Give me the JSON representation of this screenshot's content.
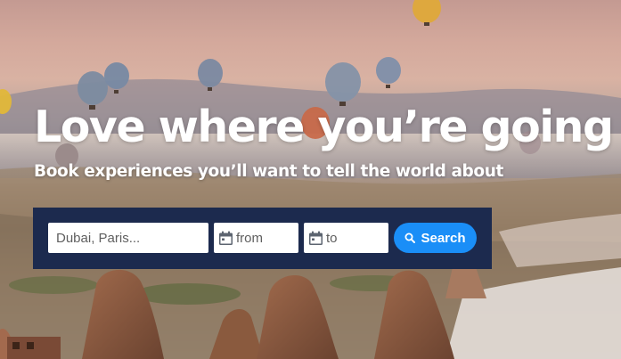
{
  "hero": {
    "headline": "Love where you’re going",
    "subheadline": "Book experiences you’ll want to tell the world about"
  },
  "search": {
    "destination_placeholder": "Dubai, Paris...",
    "from_placeholder": "from",
    "to_placeholder": "to",
    "button_label": "Search"
  },
  "colors": {
    "panel_bg": "#1c2a4e",
    "button_bg": "#1a8ef7",
    "text_white": "#ffffff"
  },
  "icons": [
    "calendar-icon",
    "search-icon"
  ]
}
